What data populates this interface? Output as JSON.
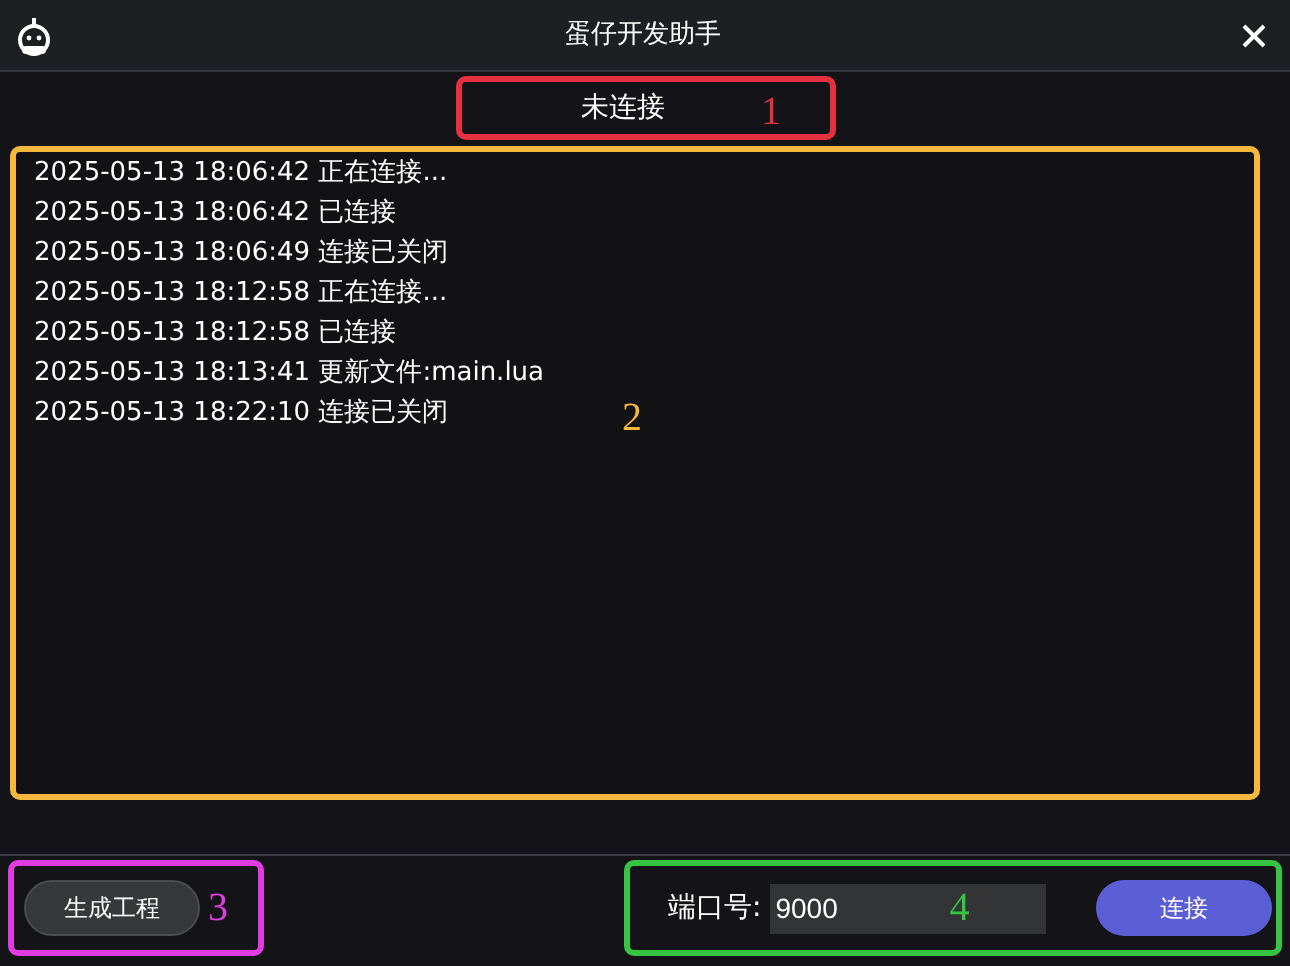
{
  "window": {
    "title": "蛋仔开发助手"
  },
  "status": {
    "text": "未连接",
    "annotation": {
      "label": "1",
      "color": "#e5303f"
    }
  },
  "log": {
    "lines": [
      "2025-05-13 18:06:42 正在连接...",
      "2025-05-13 18:06:42 已连接",
      "2025-05-13 18:06:49 连接已关闭",
      "2025-05-13 18:12:58 正在连接...",
      "2025-05-13 18:12:58 已连接",
      "2025-05-13 18:13:41 更新文件:main.lua",
      "2025-05-13 18:22:10 连接已关闭"
    ],
    "annotation": {
      "label": "2",
      "color": "#f5b83d"
    }
  },
  "generate_button": {
    "label": "生成工程",
    "annotation": {
      "label": "3",
      "color": "#e03ce0"
    }
  },
  "port": {
    "label": "端口号:",
    "value": "9000",
    "annotation": {
      "label": "4",
      "color": "#36c443"
    }
  },
  "connect_button": {
    "label": "连接"
  }
}
